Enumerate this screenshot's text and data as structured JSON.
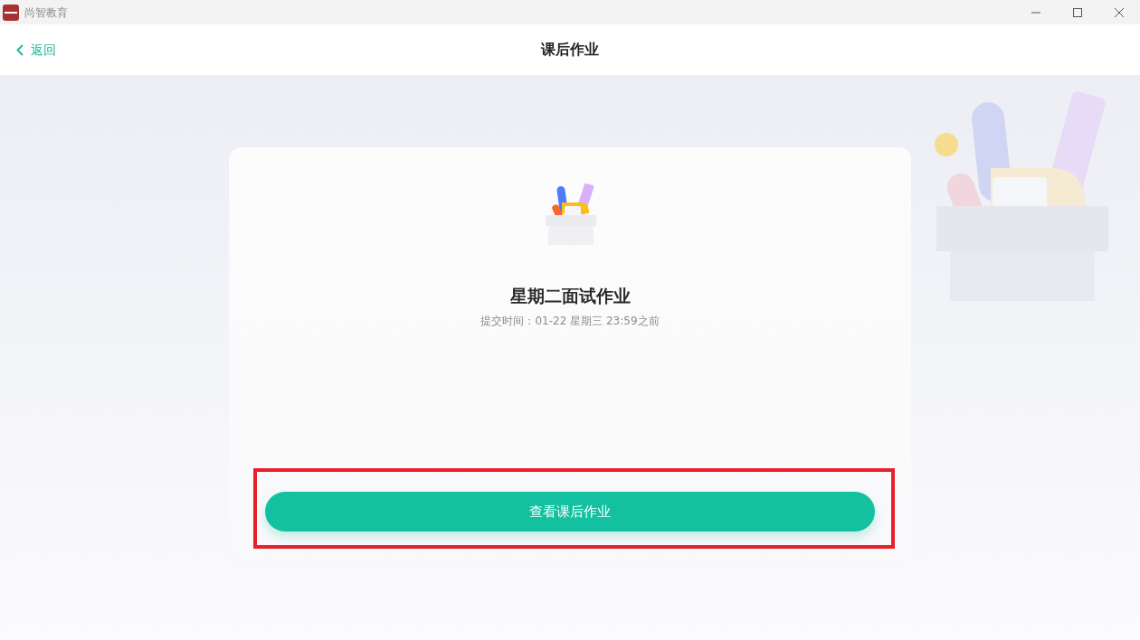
{
  "window": {
    "title": "尚智教育"
  },
  "header": {
    "back_label": "返回",
    "title": "课后作业"
  },
  "homework": {
    "title": "星期二面试作业",
    "deadline": "提交时间：01-22 星期三 23:59之前",
    "button_label": "查看课后作业"
  }
}
